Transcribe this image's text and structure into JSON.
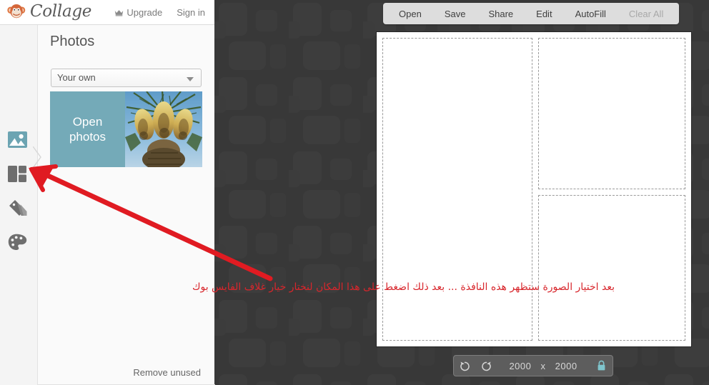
{
  "header": {
    "logo_text": "Collage",
    "logo_icon": "monkey-face-icon",
    "upgrade_label": "Upgrade",
    "upgrade_icon": "crown-icon",
    "signin_label": "Sign in"
  },
  "sidebar": {
    "items": [
      {
        "name": "photos",
        "icon": "image-icon",
        "active": true
      },
      {
        "name": "layouts",
        "icon": "grid-layout-icon",
        "active": false
      },
      {
        "name": "backgrounds",
        "icon": "swatches-icon",
        "active": false
      },
      {
        "name": "effects",
        "icon": "palette-icon",
        "active": false
      }
    ]
  },
  "panel": {
    "title": "Photos",
    "source_dropdown": {
      "value": "Your own",
      "caret_icon": "chevron-down-icon"
    },
    "open_photos_label_line1": "Open",
    "open_photos_label_line2": "photos",
    "thumbnail_alt": "date-palm-fruit-photo",
    "remove_unused_label": "Remove unused"
  },
  "toolbar": {
    "items": [
      {
        "label": "Open",
        "disabled": false
      },
      {
        "label": "Save",
        "disabled": false
      },
      {
        "label": "Share",
        "disabled": false
      },
      {
        "label": "Edit",
        "disabled": false
      },
      {
        "label": "AutoFill",
        "disabled": false
      },
      {
        "label": "Clear All",
        "disabled": true
      }
    ]
  },
  "status_bar": {
    "rotate_left_icon": "rotate-counterclockwise-icon",
    "rotate_right_icon": "rotate-clockwise-icon",
    "width_value": "2000",
    "separator": "x",
    "height_value": "2000",
    "lock_icon": "lock-icon",
    "lock_color": "#7fc4cc"
  },
  "canvas": {
    "cells": [
      "cell-left-tall",
      "cell-top-right",
      "cell-bottom-right"
    ]
  },
  "annotation": {
    "text": "بعد اختيار الصورة ستظهر هذه النافذة ... بعد ذلك اضغط على هذا المكان لنختار خيار غلاف الفايس بوك",
    "color": "#d8262c",
    "arrow": "red-arrow-pointing-to-layouts-tab"
  },
  "colors": {
    "accent_teal": "#74aab8",
    "workspace_dark": "#383838",
    "panel_light": "#fafafa",
    "toolbar_gray": "#dddddd"
  }
}
